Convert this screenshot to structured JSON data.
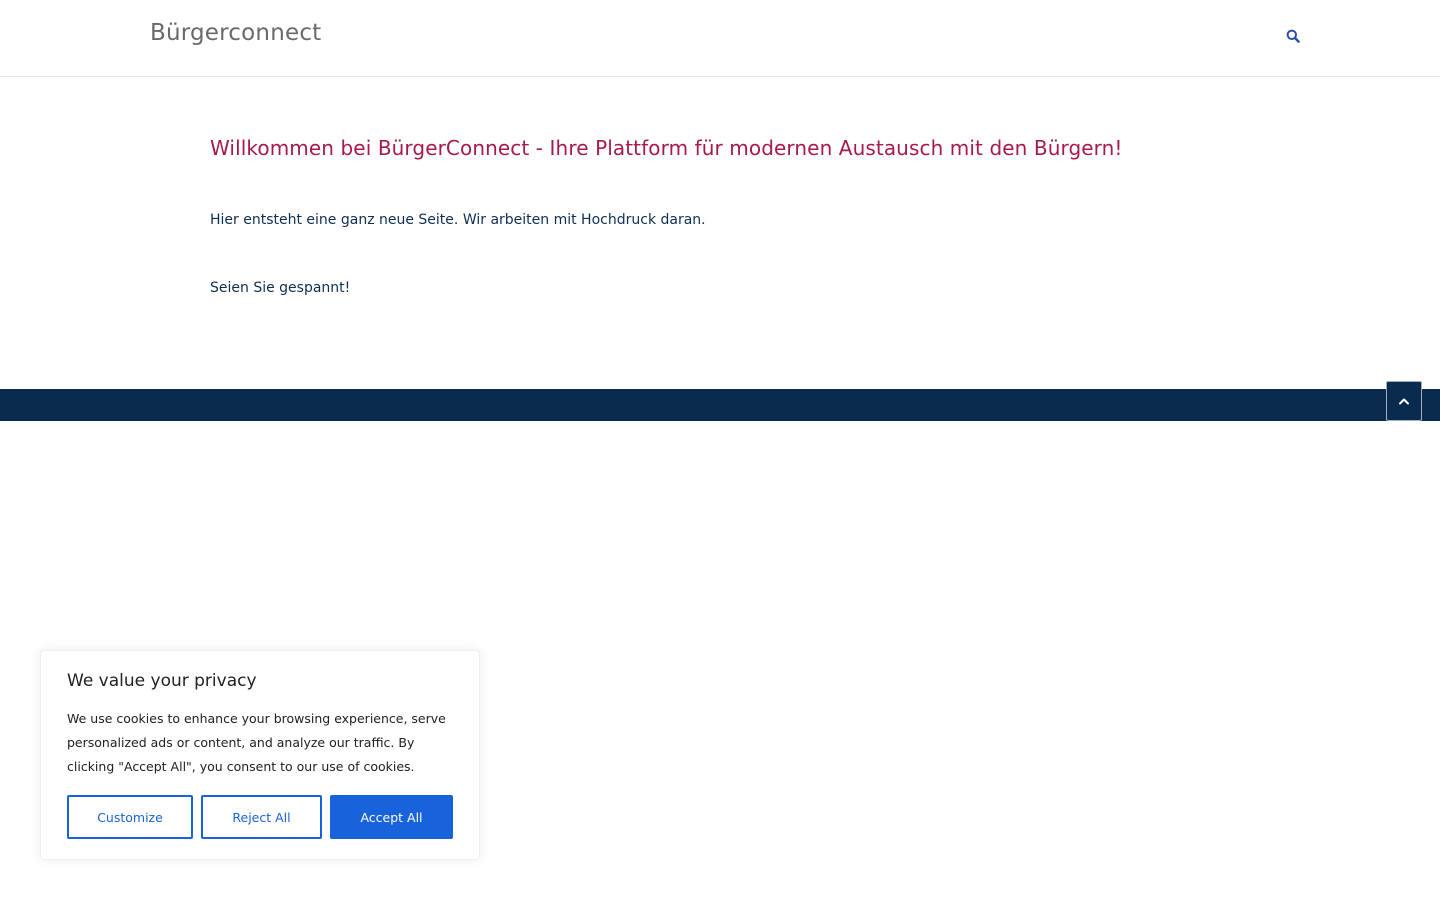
{
  "header": {
    "site_title": "Bürgerconnect",
    "search_icon": "search-icon"
  },
  "main": {
    "heading": "Willkommen bei BürgerConnect - Ihre Plattform für modernen Austausch mit den Bürgern!",
    "paragraph_1": "Hier entsteht eine ganz neue Seite. Wir arbeiten mit Hochdruck daran.",
    "paragraph_2": "Seien Sie gespannt!"
  },
  "footer": {
    "back_to_top_icon": "chevron-up-icon"
  },
  "cookie_banner": {
    "title": "We value your privacy",
    "text": "We use cookies to enhance your browsing experience, serve personalized ads or content, and analyze our traffic. By clicking \"Accept All\", you consent to our use of cookies.",
    "customize_label": "Customize",
    "reject_label": "Reject All",
    "accept_label": "Accept All"
  },
  "colors": {
    "heading": "#a81a4d",
    "body_text": "#0e2f55",
    "footer_bg": "#0b2b4e",
    "accent": "#1863dc",
    "search_icon": "#2a4fb0"
  }
}
